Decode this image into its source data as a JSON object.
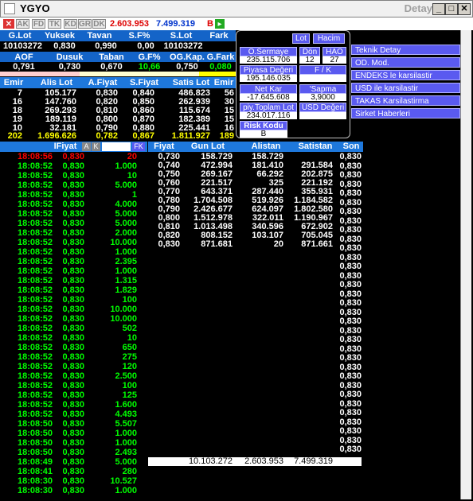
{
  "window": {
    "title": "YGYO",
    "subtitle": "Detay",
    "min": "_",
    "max": "□",
    "close": "✕"
  },
  "toolbar": {
    "close": "✕",
    "tabs": [
      "AK",
      "FD",
      "TK",
      "KD",
      "GR",
      "DK"
    ],
    "value1": "2.603.953",
    "value2": "7.499.319",
    "b_label": "B"
  },
  "summary": {
    "headers1": [
      "G.Lot",
      "Yuksek",
      "Tavan",
      "S.F%",
      "S.Lot",
      "Fark"
    ],
    "values1": [
      "10103272",
      "0,830",
      "0,990",
      "0,00",
      "10103272",
      ""
    ],
    "headers2": [
      "AOF",
      "Dusuk",
      "Taban",
      "G.F%",
      "OG.Kap.",
      "G.Fark"
    ],
    "values2": [
      "0,791",
      "0,730",
      "0,670",
      "10,66",
      "0,750",
      "0,080"
    ]
  },
  "depth": {
    "headers": [
      "Emir",
      "Alis Lot",
      "A.Fiyat",
      "S.Fiyat",
      "Satis Lot",
      "Emir"
    ],
    "rows": [
      [
        "7",
        "105.177",
        "0,830",
        "0,840",
        "486.823",
        "56"
      ],
      [
        "16",
        "147.760",
        "0,820",
        "0,850",
        "262.939",
        "30"
      ],
      [
        "18",
        "269.293",
        "0,810",
        "0,860",
        "115.674",
        "15"
      ],
      [
        "19",
        "189.119",
        "0,800",
        "0,870",
        "182.389",
        "15"
      ],
      [
        "10",
        "32.181",
        "0,790",
        "0,880",
        "225.441",
        "16"
      ]
    ],
    "totals": [
      "202",
      "1.696.626",
      "0,782",
      "0,867",
      "1.811.927",
      "189"
    ]
  },
  "info_panel": {
    "btn_lot": "Lot",
    "btn_hacim": "Hacim",
    "o_sermaye_label": "O.Sermaye",
    "o_sermaye_val": "235.115.706",
    "don_label": "Dön",
    "don_val": "12",
    "hao_label": "HAO",
    "hao_val": "27",
    "piyasa_label": "Piyasa Değeri",
    "piyasa_val": "195.146.035",
    "fk_label": "F / K",
    "fk_val": "",
    "netkar_label": "Net Kar",
    "netkar_val": "-17.645.608",
    "sapma_label": "'Sapma",
    "sapma_val": "3,9000",
    "piy_label": "piy.Toplam Lot",
    "piy_val": "234.017.116",
    "usd_label": "USD Değeri",
    "usd_val": "",
    "risk_label": "Risk Kodu",
    "risk_val": "B"
  },
  "right_menu": [
    "Teknik Detay",
    "OD. Mod.",
    "ENDEKS le karsilastir",
    "USD ile karsilastir",
    "TAKAS Karsilastirma",
    "Sirket Haberleri"
  ],
  "trades": {
    "header_fiyat": "IFiyat",
    "header_a": "A",
    "header_k": "K",
    "header_fk": "FK",
    "rows": [
      [
        "18:08:56",
        "0,830",
        "20",
        "red"
      ],
      [
        "18:08:52",
        "0,830",
        "1.000",
        "green"
      ],
      [
        "18:08:52",
        "0,830",
        "10",
        "green"
      ],
      [
        "18:08:52",
        "0,830",
        "5.000",
        "green"
      ],
      [
        "18:08:52",
        "0,830",
        "1",
        "green"
      ],
      [
        "18:08:52",
        "0,830",
        "4.000",
        "green"
      ],
      [
        "18:08:52",
        "0,830",
        "5.000",
        "green"
      ],
      [
        "18:08:52",
        "0,830",
        "5.000",
        "green"
      ],
      [
        "18:08:52",
        "0,830",
        "2.000",
        "green"
      ],
      [
        "18:08:52",
        "0,830",
        "10.000",
        "green"
      ],
      [
        "18:08:52",
        "0,830",
        "1.000",
        "green"
      ],
      [
        "18:08:52",
        "0,830",
        "2.395",
        "green"
      ],
      [
        "18:08:52",
        "0,830",
        "1.000",
        "green"
      ],
      [
        "18:08:52",
        "0,830",
        "1.315",
        "green"
      ],
      [
        "18:08:52",
        "0,830",
        "1.829",
        "green"
      ],
      [
        "18:08:52",
        "0,830",
        "100",
        "green"
      ],
      [
        "18:08:52",
        "0,830",
        "10.000",
        "green"
      ],
      [
        "18:08:52",
        "0,830",
        "10.000",
        "green"
      ],
      [
        "18:08:52",
        "0,830",
        "502",
        "green"
      ],
      [
        "18:08:52",
        "0,830",
        "10",
        "green"
      ],
      [
        "18:08:52",
        "0,830",
        "650",
        "green"
      ],
      [
        "18:08:52",
        "0,830",
        "275",
        "green"
      ],
      [
        "18:08:52",
        "0,830",
        "120",
        "green"
      ],
      [
        "18:08:52",
        "0,830",
        "2.500",
        "green"
      ],
      [
        "18:08:52",
        "0,830",
        "100",
        "green"
      ],
      [
        "18:08:52",
        "0,830",
        "125",
        "green"
      ],
      [
        "18:08:52",
        "0,830",
        "1.600",
        "green"
      ],
      [
        "18:08:52",
        "0,830",
        "4.493",
        "green"
      ],
      [
        "18:08:50",
        "0,830",
        "5.507",
        "green"
      ],
      [
        "18:08:50",
        "0,830",
        "1.000",
        "green"
      ],
      [
        "18:08:50",
        "0,830",
        "1.000",
        "green"
      ],
      [
        "18:08:50",
        "0,830",
        "2.493",
        "green"
      ],
      [
        "18:08:49",
        "0,830",
        "5.000",
        "green"
      ],
      [
        "18:08:41",
        "0,830",
        "280",
        "green"
      ],
      [
        "18:08:30",
        "0,830",
        "10.527",
        "green"
      ],
      [
        "18:08:30",
        "0,830",
        "1.000",
        "green"
      ]
    ]
  },
  "price_table": {
    "headers": [
      "Fiyat",
      "Gun Lot",
      "Alistan",
      "Satistan",
      "Son"
    ],
    "rows": [
      [
        "0,730",
        "158.729",
        "158.729",
        ""
      ],
      [
        "0,740",
        "472.994",
        "181.410",
        "291.584"
      ],
      [
        "0,750",
        "269.167",
        "66.292",
        "202.875"
      ],
      [
        "0,760",
        "221.517",
        "325",
        "221.192"
      ],
      [
        "0,770",
        "643.371",
        "287.440",
        "355.931"
      ],
      [
        "0,780",
        "1.704.508",
        "519.926",
        "1.184.582"
      ],
      [
        "0,790",
        "2.426.677",
        "624.097",
        "1.802.580"
      ],
      [
        "0,800",
        "1.512.978",
        "322.011",
        "1.190.967"
      ],
      [
        "0,810",
        "1.013.498",
        "340.596",
        "672.902"
      ],
      [
        "0,820",
        "808.152",
        "103.107",
        "705.045"
      ],
      [
        "0,830",
        "871.681",
        "20",
        "871.661"
      ]
    ],
    "totals": [
      "10.103.272",
      "2.603.953",
      "7.499.319"
    ]
  },
  "son_column": [
    "0,830",
    "0,830",
    "0,830",
    "0,830",
    "0,830",
    "0,830",
    "0,830",
    "0,830",
    "0,830",
    "0,830",
    "0,830",
    "0,830",
    "0,830",
    "0,830",
    "0,830",
    "0,830",
    "0,830",
    "0,830",
    "0,830",
    "0,830",
    "0,830",
    "0,830",
    "0,830",
    "0,830",
    "0,830",
    "0,830",
    "0,830",
    "0,830",
    "0,830",
    "0,830",
    "0,830",
    "0,830",
    "0,830"
  ]
}
